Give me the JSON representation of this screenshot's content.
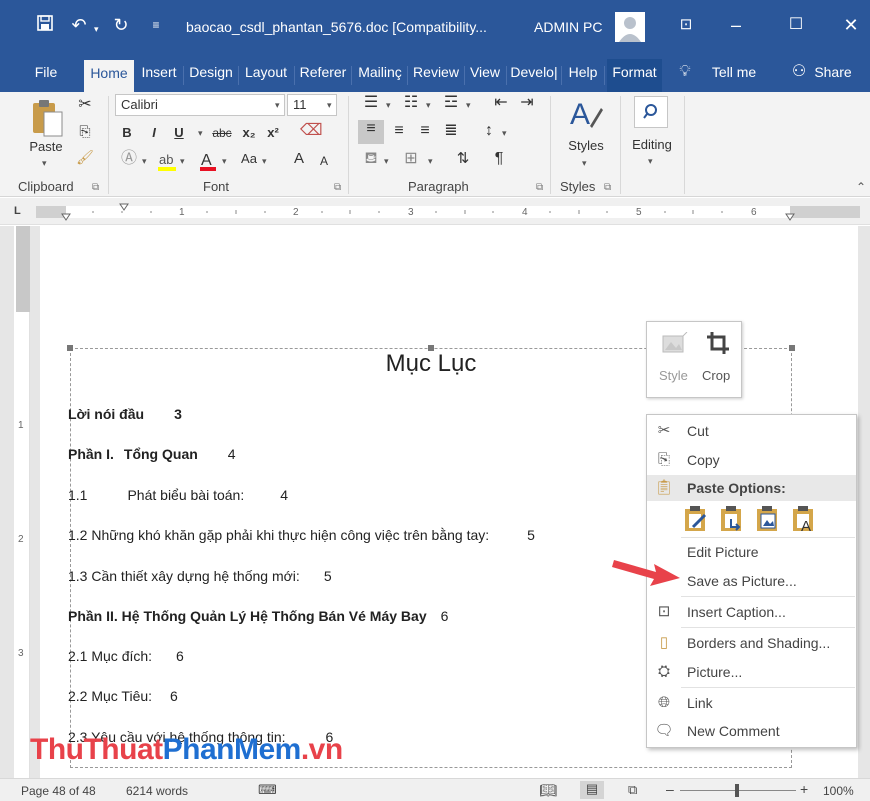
{
  "titlebar": {
    "doc_title": "baocao_csdl_phantan_5676.doc [Compatibility...",
    "user": "ADMIN PC"
  },
  "tabs": [
    "File",
    "Home",
    "Insert",
    "Design",
    "Layout",
    "Referer",
    "Mailinç",
    "Review",
    "View",
    "Develo|",
    "Help",
    "Format"
  ],
  "tell_me": "Tell me",
  "share": "Share",
  "ribbon": {
    "paste": "Paste",
    "clipboard": "Clipboard",
    "font_name": "Calibri",
    "font_size": "11",
    "font": "Font",
    "paragraph": "Paragraph",
    "styles_btn": "Styles",
    "styles": "Styles",
    "editing": "Editing",
    "bold": "B",
    "italic": "I",
    "underline": "U",
    "strike": "abc",
    "sub": "x₂",
    "sup": "x²",
    "case": "Aa",
    "grow": "A",
    "shrink": "A",
    "pilcrow": "¶"
  },
  "document": {
    "title": "Mục Lục",
    "lines": [
      {
        "text": "Lời nói đầu",
        "page": "3"
      },
      {
        "text": "Phần I.",
        "text2": "Tổng Quan",
        "page": "4"
      },
      {
        "text": "1.1",
        "text2": "Phát biểu bài toán:",
        "page": "4"
      },
      {
        "text": "1.2 Những khó khăn gặp phải khi thực hiện công việc trên bằng tay:",
        "page": "5"
      },
      {
        "text": "1.3 Cần thiết xây dựng hệ thống mới:",
        "page": "5"
      },
      {
        "text": "Phần II. Hệ Thống Quản Lý Hệ Thống Bán Vé Máy Bay",
        "page": "6"
      },
      {
        "text": "2.1 Mục đích:",
        "page": "6"
      },
      {
        "text": "2.2 Mục Tiêu:",
        "page": "6"
      },
      {
        "text": "2.3 Yêu cầu với hệ thống thông tin:",
        "page": "6"
      }
    ]
  },
  "mini_toolbar": {
    "style": "Style",
    "crop": "Crop"
  },
  "context_menu": {
    "cut": "Cut",
    "copy": "Copy",
    "paste_options": "Paste Options:",
    "edit_picture": "Edit Picture",
    "save_as_picture": "Save as Picture...",
    "insert_caption": "Insert Caption...",
    "borders_shading": "Borders and Shading...",
    "picture": "Picture...",
    "link": "Link",
    "new_comment": "New Comment"
  },
  "status": {
    "page": "Page 48 of 48",
    "words": "6214 words",
    "zoom": "100%"
  },
  "watermark": "ThuThuatPhanMem.vn",
  "colors": {
    "accent": "#2b579a",
    "arrow": "#e8424a"
  }
}
